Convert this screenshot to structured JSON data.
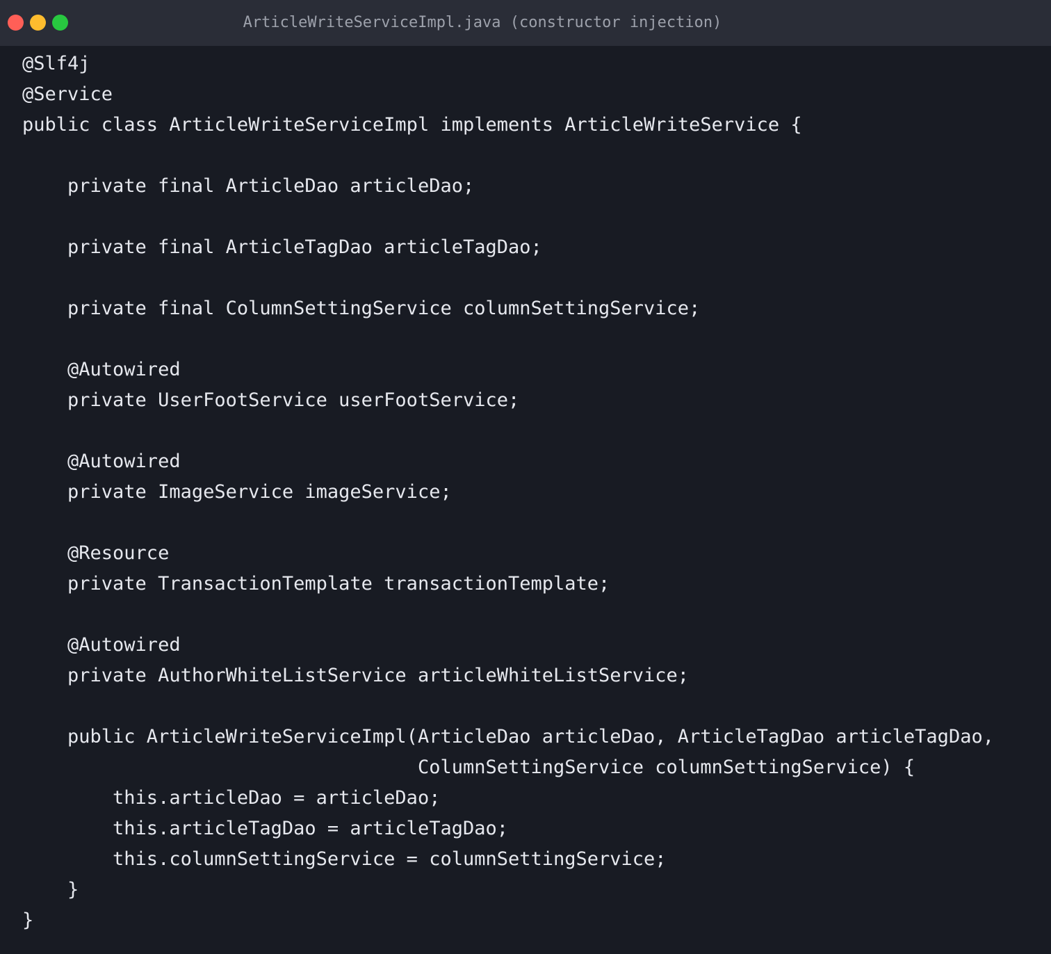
{
  "window": {
    "title": "ArticleWriteServiceImpl.java (constructor injection)",
    "colors": {
      "close": "#ff5f57",
      "minimize": "#febc2e",
      "zoom": "#28c840",
      "background": "#181b23",
      "titlebar": "#2a2d37",
      "text": "#e6e8ee"
    }
  },
  "editor": {
    "lines": [
      "@Slf4j",
      "@Service",
      "public class ArticleWriteServiceImpl implements ArticleWriteService {",
      "",
      "    private final ArticleDao articleDao;",
      "",
      "    private final ArticleTagDao articleTagDao;",
      "",
      "    private final ColumnSettingService columnSettingService;",
      "",
      "    @Autowired",
      "    private UserFootService userFootService;",
      "",
      "    @Autowired",
      "    private ImageService imageService;",
      "",
      "    @Resource",
      "    private TransactionTemplate transactionTemplate;",
      "",
      "    @Autowired",
      "    private AuthorWhiteListService articleWhiteListService;",
      "",
      "    public ArticleWriteServiceImpl(ArticleDao articleDao, ArticleTagDao articleTagDao,",
      "                                   ColumnSettingService columnSettingService) {",
      "        this.articleDao = articleDao;",
      "        this.articleTagDao = articleTagDao;",
      "        this.columnSettingService = columnSettingService;",
      "    }",
      "}"
    ]
  }
}
